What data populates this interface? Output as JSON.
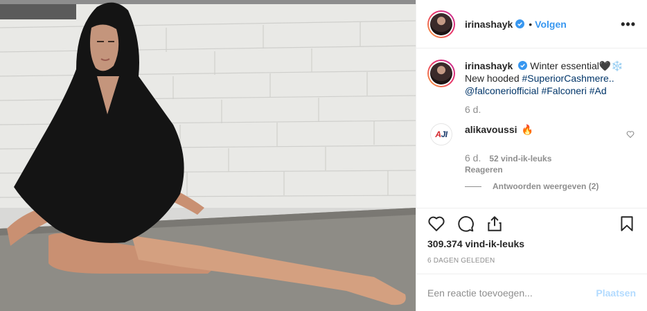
{
  "post": {
    "photo_alt": "",
    "author": {
      "username": "irinashayk",
      "follow_label": "Volgen",
      "separator": "•"
    },
    "more_label": "•••",
    "caption": {
      "username": "irinashayk",
      "text_start": "Winter essential🖤❄️",
      "line2_start": "New hooded ",
      "hashtag1": "#SuperiorCashmere..",
      "mention": "@falconeriofficial",
      "hashtag2": "#Falconeri",
      "hashtag3": "#Ad",
      "age": "6 d."
    },
    "comments": [
      {
        "username": "alikavoussi",
        "avatar_text_a": "A",
        "avatar_text_b": "JI",
        "text": "🔥",
        "age": "6 d.",
        "likes": "52 vind-ik-leuks",
        "reply_label": "Reageren",
        "view_replies": "Antwoorden weergeven (2)"
      }
    ],
    "likes_count": "309.374 vind-ik-leuks",
    "date": "6 DAGEN GELEDEN",
    "add_comment": {
      "placeholder": "Een reactie toevoegen...",
      "post_label": "Plaatsen"
    },
    "colors": {
      "link": "#003569",
      "follow": "#3897f0",
      "muted": "#8e8e8e",
      "post_disabled": "#b3dbff"
    },
    "icons": [
      "verified-icon",
      "heart-icon",
      "comment-icon",
      "share-icon",
      "bookmark-icon",
      "more-icon"
    ]
  }
}
